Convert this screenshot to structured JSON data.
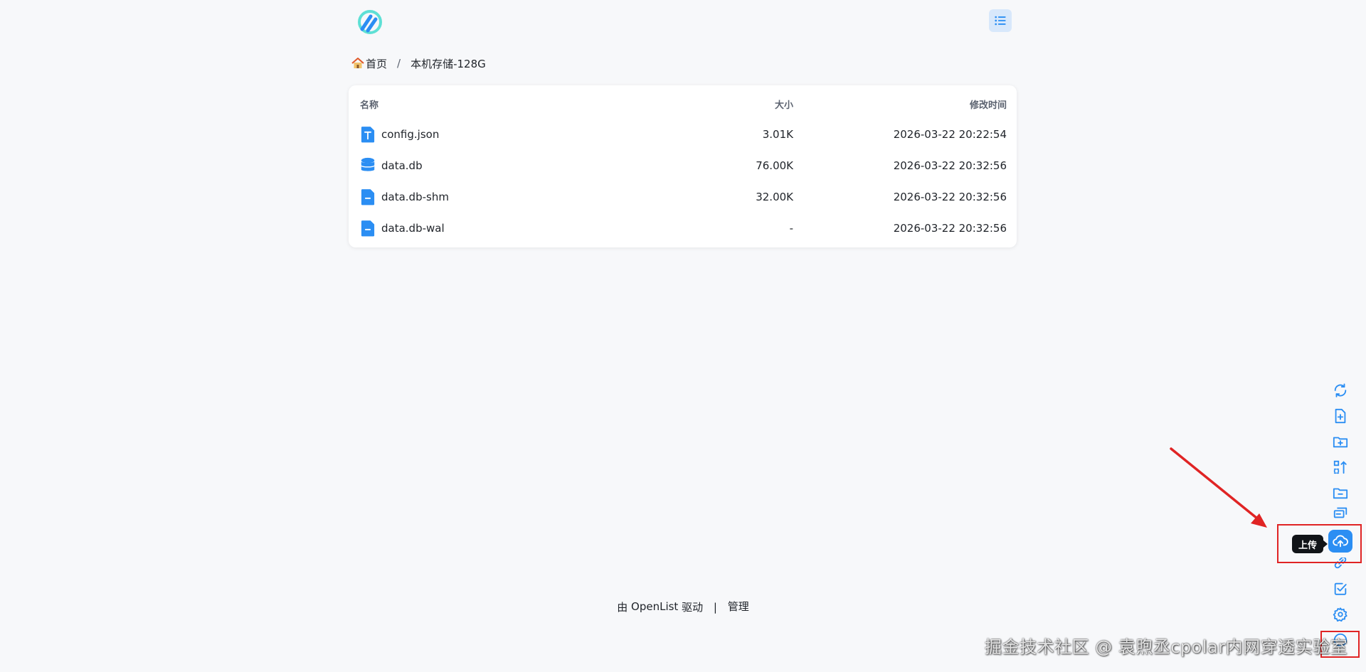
{
  "header": {
    "logo_icon": "openlist-logo-icon",
    "menu_icon": "list-menu-icon"
  },
  "breadcrumb": {
    "home_label": "首页",
    "separator": "/",
    "current_label": "本机存储-128G"
  },
  "table": {
    "columns": {
      "name": "名称",
      "size": "大小",
      "modified": "修改时间"
    },
    "rows": [
      {
        "name": "config.json",
        "size": "3.01K",
        "modified": "2026-03-22 20:22:54",
        "icon": "text-file-icon"
      },
      {
        "name": "data.db",
        "size": "76.00K",
        "modified": "2026-03-22 20:32:56",
        "icon": "database-icon"
      },
      {
        "name": "data.db-shm",
        "size": "32.00K",
        "modified": "2026-03-22 20:32:56",
        "icon": "generic-file-icon"
      },
      {
        "name": "data.db-wal",
        "size": "-",
        "modified": "2026-03-22 20:32:56",
        "icon": "generic-file-icon"
      }
    ]
  },
  "footer": {
    "powered_by_prefix": "由",
    "product": "OpenList",
    "powered_by_suffix": "驱动",
    "separator": "|",
    "admin_label": "管理"
  },
  "toolbar": {
    "buttons": [
      "refresh-icon",
      "new-file-icon",
      "new-folder-icon",
      "sort-icon",
      "folder-minus-icon",
      "batch-rename-icon",
      "upload-icon",
      "link-icon",
      "checkbox-icon",
      "settings-icon",
      "toggle-icon"
    ],
    "tooltip": "上传"
  },
  "watermark": "掘金技术社区 @ 袁煦丞cpolar内网穿透实验室",
  "colors": {
    "accent": "#2b8ef3",
    "annotation": "#e02424",
    "background": "#f7f8fa"
  }
}
